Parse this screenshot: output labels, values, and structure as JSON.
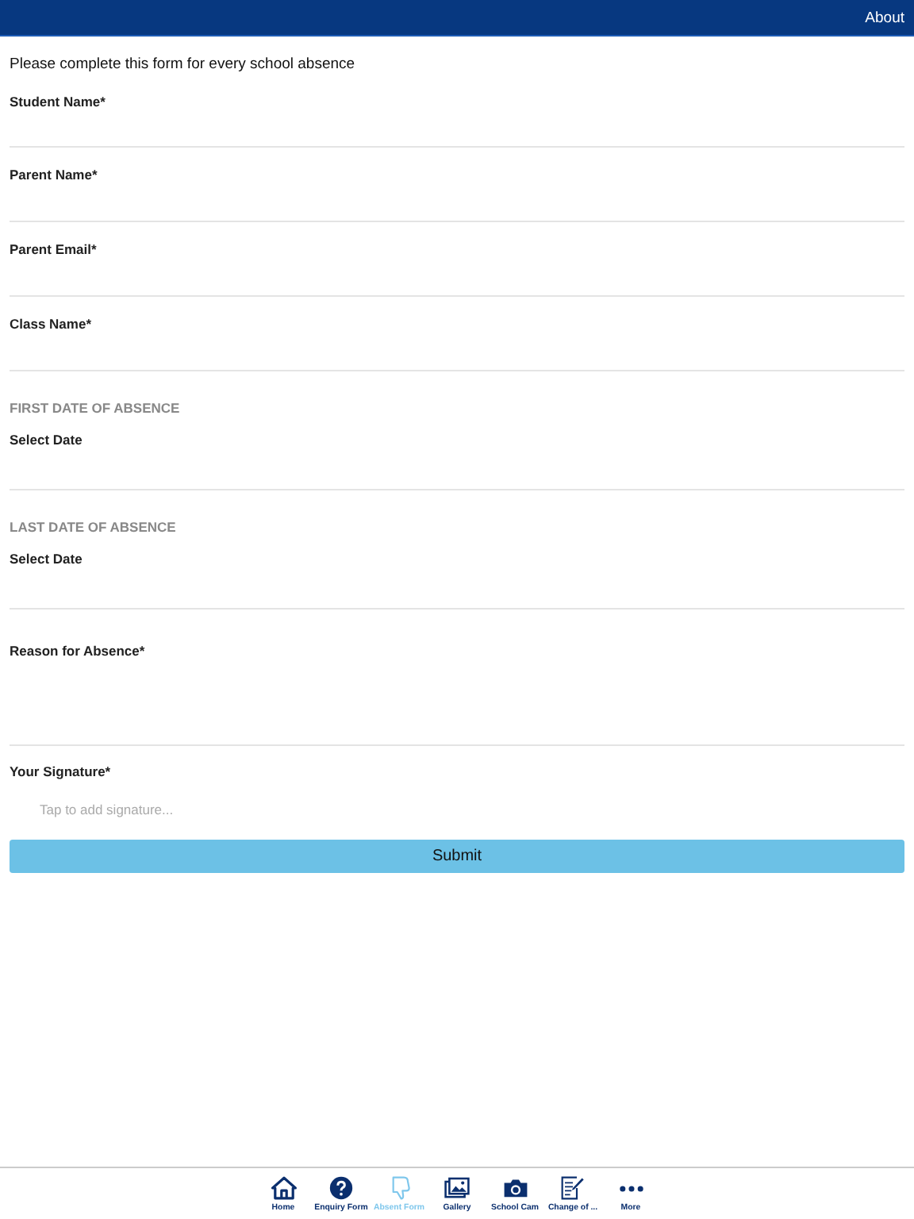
{
  "header": {
    "about": "About"
  },
  "intro": "Please complete this form for every school absence",
  "fields": [
    {
      "kind": "text",
      "label": "Student Name*"
    },
    {
      "kind": "text",
      "label": "Parent Name*"
    },
    {
      "kind": "text",
      "label": "Parent Email*"
    },
    {
      "kind": "text",
      "label": "Class Name*"
    },
    {
      "kind": "date",
      "section": "FIRST DATE OF ABSENCE",
      "label": "Select Date"
    },
    {
      "kind": "date",
      "section": "LAST DATE OF ABSENCE",
      "label": "Select Date"
    },
    {
      "kind": "textarea",
      "label": "Reason for Absence*"
    }
  ],
  "signature": {
    "label": "Your Signature*",
    "placeholder": "Tap to add signature..."
  },
  "submit": "Submit",
  "tabs": [
    {
      "label": "Home",
      "selected": false
    },
    {
      "label": "Enquiry Form",
      "selected": false
    },
    {
      "label": "Absent Form",
      "selected": true
    },
    {
      "label": "Gallery",
      "selected": false
    },
    {
      "label": "School Cam",
      "selected": false
    },
    {
      "label": "Change of ...",
      "selected": false
    },
    {
      "label": "More",
      "selected": false
    }
  ]
}
